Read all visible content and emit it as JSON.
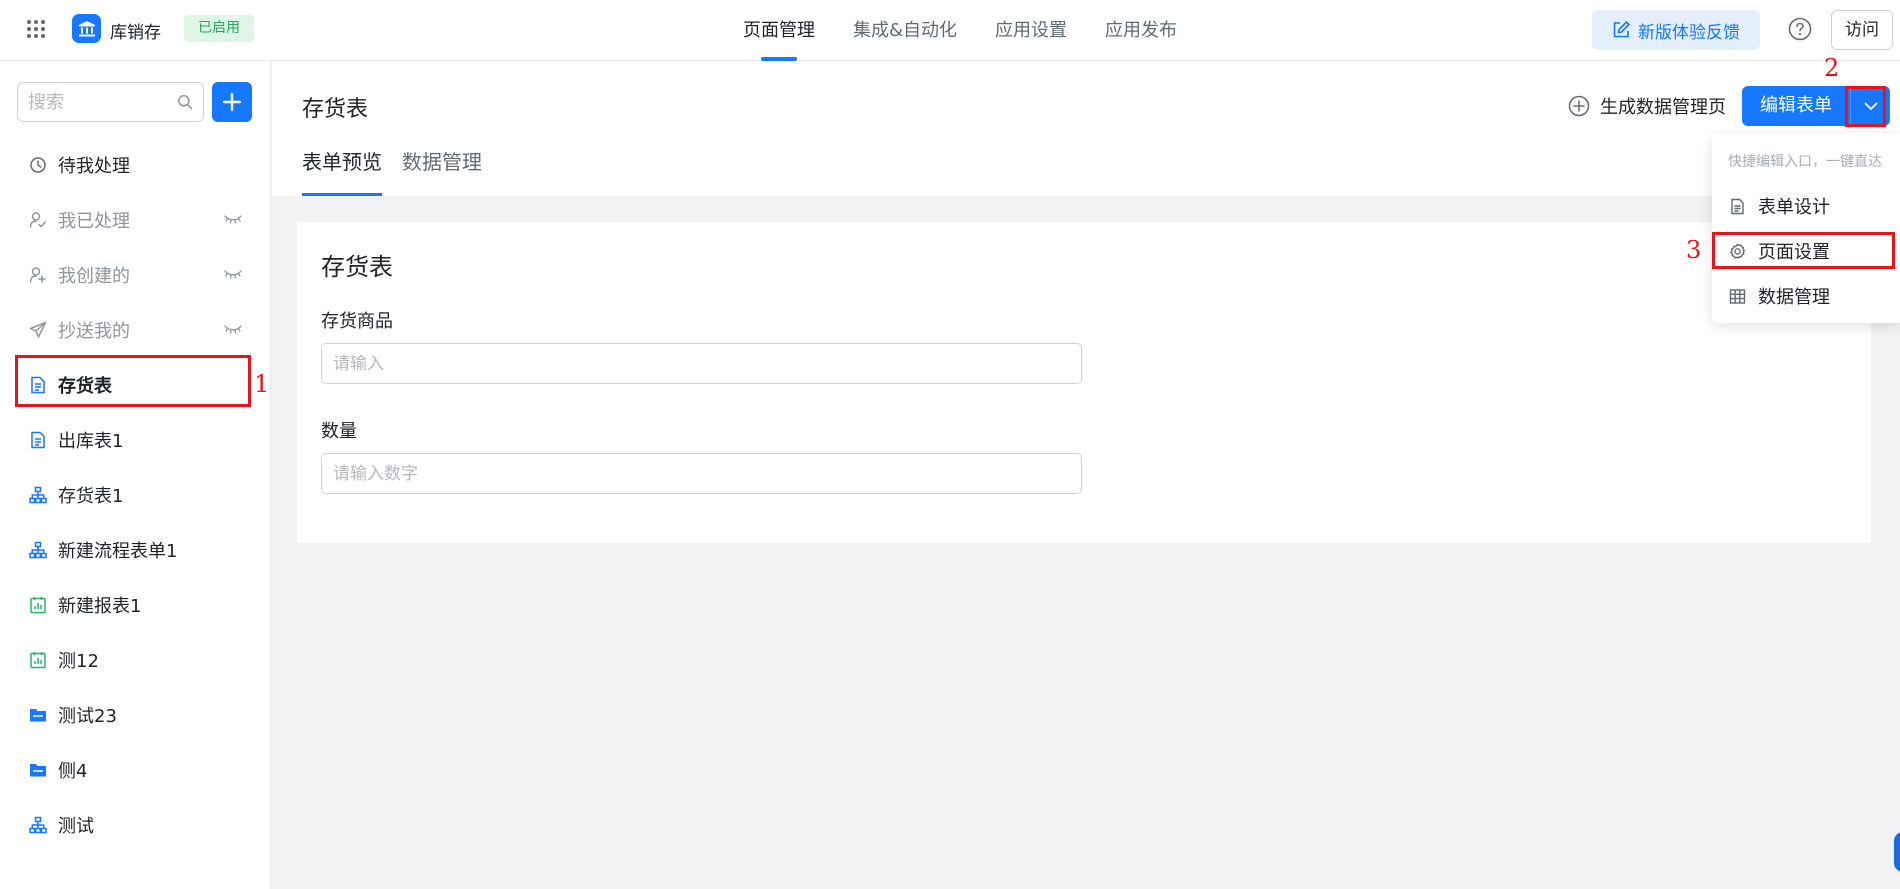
{
  "topbar": {
    "app_name": "库销存",
    "status": "已启用",
    "nav": [
      "页面管理",
      "集成&自动化",
      "应用设置",
      "应用发布"
    ],
    "feedback": "新版体验反馈",
    "visit": "访问"
  },
  "sidebar": {
    "search_placeholder": "搜索",
    "items": [
      {
        "label": "待我处理",
        "icon": "clock-icon"
      },
      {
        "label": "我已处理",
        "icon": "user-check-icon"
      },
      {
        "label": "我创建的",
        "icon": "user-add-icon"
      },
      {
        "label": "抄送我的",
        "icon": "send-icon"
      },
      {
        "label": "存货表",
        "icon": "form-doc-icon"
      },
      {
        "label": "出库表1",
        "icon": "form-doc-icon"
      },
      {
        "label": "存货表1",
        "icon": "flow-icon"
      },
      {
        "label": "新建流程表单1",
        "icon": "flow-icon"
      },
      {
        "label": "新建报表1",
        "icon": "report-icon"
      },
      {
        "label": "测12",
        "icon": "report-icon"
      },
      {
        "label": "测试23",
        "icon": "folder-icon"
      },
      {
        "label": "侧4",
        "icon": "folder-icon"
      },
      {
        "label": "测试",
        "icon": "flow-icon"
      }
    ]
  },
  "content": {
    "title": "存货表",
    "generate_link": "生成数据管理页",
    "edit_button": "编辑表单",
    "tabs": [
      "表单预览",
      "数据管理"
    ]
  },
  "form": {
    "title": "存货表",
    "fields": [
      {
        "label": "存货商品",
        "placeholder": "请输入"
      },
      {
        "label": "数量",
        "placeholder": "请输入数字"
      }
    ]
  },
  "dropdown": {
    "hint": "快捷编辑入口，一键直达",
    "items": [
      "表单设计",
      "页面设置",
      "数据管理"
    ]
  },
  "annotations": [
    "1",
    "2",
    "3"
  ],
  "colors": {
    "accent": "#1677ff",
    "annotation": "#e8141c",
    "status_bg": "#dff5e6",
    "status_text": "#25a45a"
  }
}
